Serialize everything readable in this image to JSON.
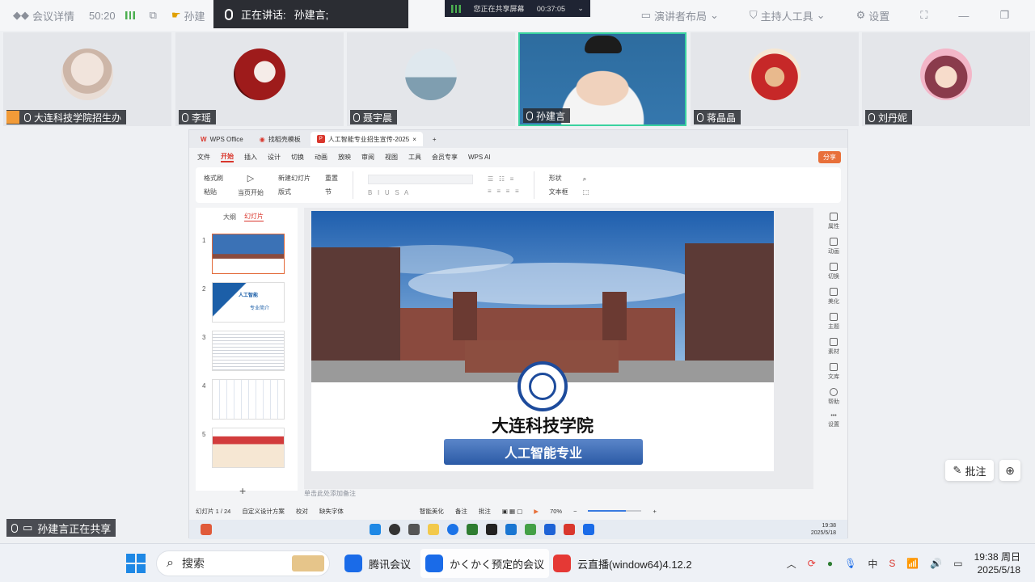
{
  "meeting_bar": {
    "details_label": "会议详情",
    "timer": "50:20",
    "speaker_short": "孙建",
    "speaking_label": "正在讲话:",
    "speaking_name": "孙建言;",
    "share_status": "您正在共享屏幕",
    "share_timer": "00:37:05",
    "layout_label": "演讲者布局",
    "host_tools_label": "主持人工具",
    "settings_label": "设置"
  },
  "participants": [
    {
      "name": "大连科技学院招生办",
      "color": "#d8c7bf"
    },
    {
      "name": "李瑶",
      "color": "#b71c1c"
    },
    {
      "name": "聂宇晨",
      "color": "#9fb8c8"
    },
    {
      "name": "孙建言",
      "color": "#2e6b9e"
    },
    {
      "name": "蒋晶晶",
      "color": "#c62828"
    },
    {
      "name": "刘丹妮",
      "color": "#f3b6c8"
    }
  ],
  "wps": {
    "tab_office": "WPS Office",
    "tab_templates": "找稻壳模板",
    "tab_doc": "人工智能专业招生宣传-2025",
    "menu": [
      "文件",
      "开始",
      "插入",
      "设计",
      "切换",
      "动画",
      "放映",
      "审阅",
      "视图",
      "工具",
      "会员专享",
      "WPS AI"
    ],
    "menu_active": "开始",
    "share": "分享",
    "ribbon": {
      "format_painter": "格式刷",
      "paste": "粘贴",
      "from_current": "当页开始",
      "new_slide": "新建幻灯片",
      "layout": "版式",
      "reset": "重置",
      "section": "节",
      "shape": "形状",
      "textbox": "文本框"
    },
    "pane_outline": "大纲",
    "pane_slides": "幻灯片",
    "slide_numbers": [
      "1",
      "2",
      "3",
      "4",
      "5"
    ],
    "thumb2_title": "人工智能",
    "thumb2_sub": "专业简介",
    "thumb2_num": "01",
    "slide_title": "大连科技学院",
    "slide_subtitle": "人工智能专业",
    "notes_placeholder": "单击此处添加备注",
    "right_tools": [
      "属性",
      "动画",
      "切换",
      "美化",
      "主题",
      "素材",
      "文库",
      "帮助",
      "设置"
    ],
    "status": {
      "slide_count": "幻灯片 1 / 24",
      "design": "自定义设计方案",
      "proof": "校对",
      "missing_font": "缺失字体",
      "beautify": "智能美化",
      "notes": "备注",
      "comments": "批注",
      "zoom": "70%",
      "zoom_fraction": 0.7
    },
    "inner_clock_time": "19:38",
    "inner_clock_date": "2025/5/18"
  },
  "floating": {
    "annotate_label": "批注",
    "sharing_notice": "孙建言正在共享"
  },
  "taskbar": {
    "search_placeholder": "搜索",
    "apps": [
      {
        "label": "腾讯会议",
        "color": "#1a6be8"
      },
      {
        "label": "かくかく预定的会议",
        "color": "#1a6be8"
      },
      {
        "label": "云直播(window64)4.12.2",
        "color": "#e53935"
      }
    ],
    "time": "19:38 周日",
    "date": "2025/5/18"
  }
}
